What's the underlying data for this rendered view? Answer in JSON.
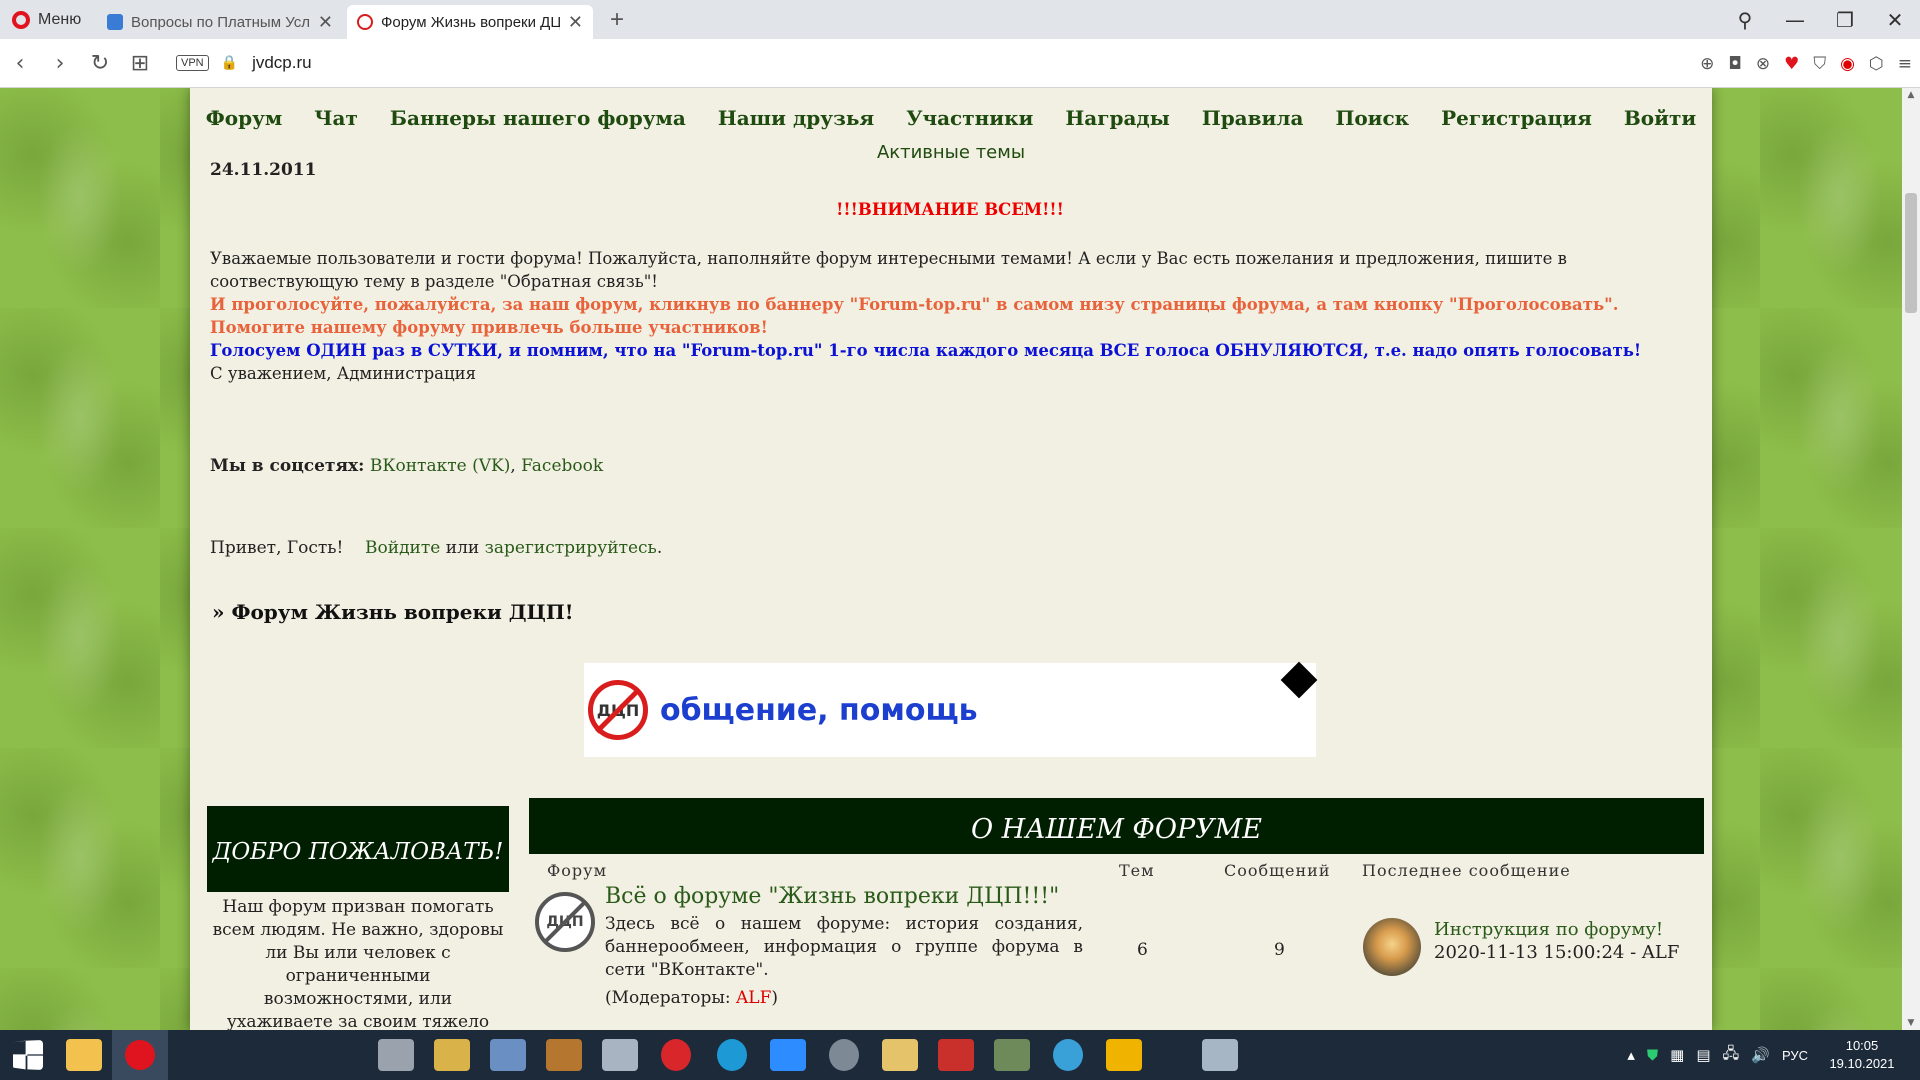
{
  "browser": {
    "menu_label": "Меню",
    "tabs": [
      {
        "title": "Вопросы по Платным Усл",
        "active": false
      },
      {
        "title": "Форум Жизнь вопреки ДЦ",
        "active": true
      }
    ],
    "url": "jvdcp.ru",
    "vpn_label": "VPN"
  },
  "nav": {
    "items": [
      "Форум",
      "Чат",
      "Баннеры нашего форума",
      "Наши друзья",
      "Участники",
      "Награды",
      "Правила",
      "Поиск",
      "Регистрация",
      "Войти"
    ],
    "active_topics": "Активные темы"
  },
  "date": "24.11.2011",
  "notice": {
    "attention": "!!!ВНИМАНИЕ ВСЕМ!!!",
    "p1": "Уважаемые пользователи и гости форума! Пожалуйста, наполняйте форум интересными темами! А если у Вас есть пожелания и предложения, пишите в соотвествующую тему в разделе \"Обратная связь\"!",
    "p2": "И проголосуйте, пожалуйста, за наш форум, кликнув по баннеру \"Forum-top.ru\" в самом низу страницы форума, а там кнопку \"Проголосовать\". Помогите нашему форуму привлечь больше участников!",
    "p3": "Голосуем ОДИН раз в СУТКИ, и помним, что на \"Forum-top.ru\" 1-го числа каждого месяца ВСЕ голоса ОБНУЛЯЮТСЯ, т.е. надо опять голосовать!",
    "sign": "С уважением, Администрация"
  },
  "social": {
    "label": "Мы в соцсетях:",
    "vk": "ВКонтакте (VK)",
    "sep": ", ",
    "fb": "Facebook"
  },
  "greeting": {
    "hello": "Привет, Гость!",
    "login": "Войдите",
    "or": " или ",
    "register": "зарегистрируйтесь",
    "dot": "."
  },
  "breadcrumb": "» Форум Жизнь вопреки ДЦП!",
  "banner": {
    "logo_text": "ДЦП",
    "text": "общение, помощь"
  },
  "welcome": {
    "title": "ДОБРО ПОЖАЛОВАТЬ!",
    "body": "Наш форум призван помогать всем людям. Не важно, здоровы ли Вы или человек с ограниченными возможностями, или ухаживаете за своим тяжело больным"
  },
  "forum": {
    "section_title": "О НАШЕМ ФОРУМЕ",
    "columns": [
      "Форум",
      "Тем",
      "Сообщений",
      "Последнее сообщение"
    ],
    "row": {
      "icon_text": "ДЦП",
      "title": "Всё о форуме \"Жизнь вопреки ДЦП!!!\"",
      "desc": "Здесь всё о нашем форуме: история создания, баннерообмеен, информация о группе форума в сети \"ВКонтакте\".",
      "mods_label": "(Модераторы: ",
      "mod_name": "ALF",
      "mods_end": ")",
      "topics": "6",
      "messages": "9",
      "last_title": "Инструкция по форуму!",
      "last_meta": "2020-11-13 15:00:24 - ALF"
    }
  },
  "tray": {
    "lang": "РУС",
    "time": "10:05",
    "date": "19.10.2021"
  },
  "colors": {
    "nav_green": "#1f4a10",
    "attention_red": "#e00000",
    "orange": "#e8633c",
    "blue": "#0b12d6",
    "header_dark": "#001e00",
    "page_bg": "#f2f0e2"
  }
}
